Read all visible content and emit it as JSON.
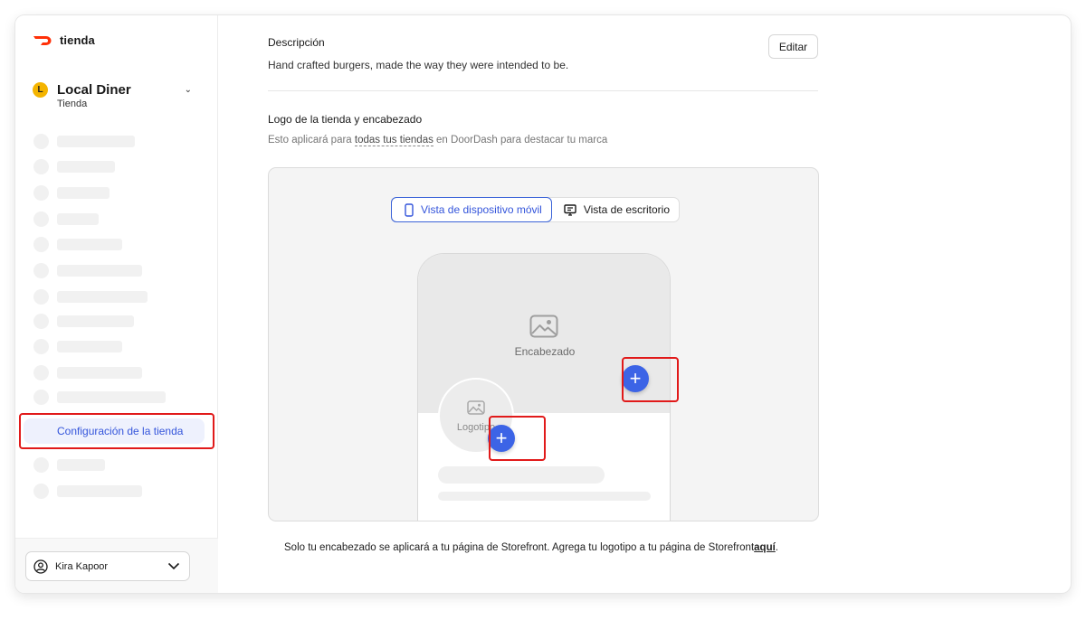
{
  "brand": {
    "name": "tienda",
    "accent": "#ff3008"
  },
  "store": {
    "initial": "L",
    "name": "Local Diner",
    "type": "Tienda",
    "avatar_color": "#f4b400"
  },
  "sidebar": {
    "active_item": "Configuración de la tienda",
    "user_name": "Kira Kapoor"
  },
  "description": {
    "label": "Descripción",
    "text": "Hand crafted burgers, made the way they were intended to be.",
    "edit_label": "Editar"
  },
  "logo_section": {
    "label": "Logo de la tienda y encabezado",
    "help_prefix": "Esto aplicará para ",
    "help_link": "todas tus tiendas",
    "help_suffix": " en DoorDash para destacar tu marca"
  },
  "preview": {
    "tabs": [
      {
        "label": "Vista de dispositivo móvil",
        "icon": "mobile-icon",
        "active": true
      },
      {
        "label": "Vista de escritorio",
        "icon": "desktop-icon",
        "active": false
      }
    ],
    "header_label": "Encabezado",
    "logo_label": "Logotipo",
    "accent": "#3c64e6"
  },
  "footer": {
    "note": "Solo tu encabezado se aplicará a tu página de Storefront. Agrega tu logotipo a tu página de Storefront",
    "link": "aquí",
    "end": "."
  }
}
